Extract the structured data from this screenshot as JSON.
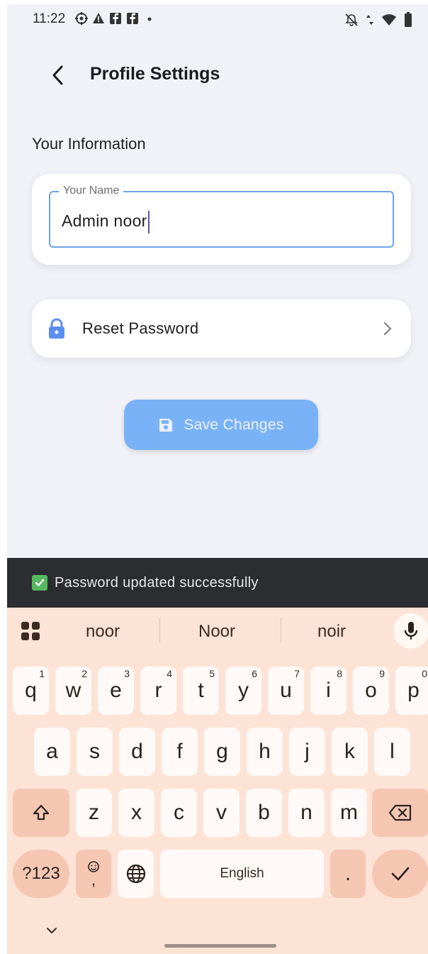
{
  "status_bar": {
    "time": "11:22",
    "left_icons": [
      "settings-gear-icon",
      "alert-triangle-icon",
      "facebook-icon",
      "facebook-icon",
      "dot-icon"
    ],
    "right_icons": [
      "notifications-off-icon",
      "data-arrows-icon",
      "wifi-icon",
      "battery-icon"
    ]
  },
  "app_bar": {
    "title": "Profile Settings",
    "back_icon": "back-arrow-icon"
  },
  "section": {
    "title": "Your Information"
  },
  "name_field": {
    "label": "Your Name",
    "value": "Admin noor"
  },
  "reset_password": {
    "label": "Reset Password",
    "icon": "lock-icon",
    "chevron": "chevron-right-icon"
  },
  "save_button": {
    "label": "Save Changes",
    "icon": "save-icon"
  },
  "snackbar": {
    "text": "Password updated successfully",
    "icon": "check-box-icon"
  },
  "keyboard": {
    "suggestions": [
      "noor",
      "Noor",
      "noir"
    ],
    "row1": [
      {
        "key": "q",
        "hint": "1"
      },
      {
        "key": "w",
        "hint": "2"
      },
      {
        "key": "e",
        "hint": "3"
      },
      {
        "key": "r",
        "hint": "4"
      },
      {
        "key": "t",
        "hint": "5"
      },
      {
        "key": "y",
        "hint": "6"
      },
      {
        "key": "u",
        "hint": "7"
      },
      {
        "key": "i",
        "hint": "8"
      },
      {
        "key": "o",
        "hint": "9"
      },
      {
        "key": "p",
        "hint": "0"
      }
    ],
    "row2": [
      "a",
      "s",
      "d",
      "f",
      "g",
      "h",
      "j",
      "k",
      "l"
    ],
    "row3": [
      "z",
      "x",
      "c",
      "v",
      "b",
      "n",
      "m"
    ],
    "symbols_label": "?123",
    "emoji_comma_label": ",",
    "space_label": "English",
    "period_label": ".",
    "colors": {
      "background": "#fde3d6",
      "key": "#fffaf7",
      "modifier_key": "#f5c7b3"
    }
  },
  "colors": {
    "accent": "#6ea3e6",
    "save_button": "#7ab2f8",
    "snackbar": "#2c2d30",
    "screen_bg": "#f1f2f8"
  }
}
